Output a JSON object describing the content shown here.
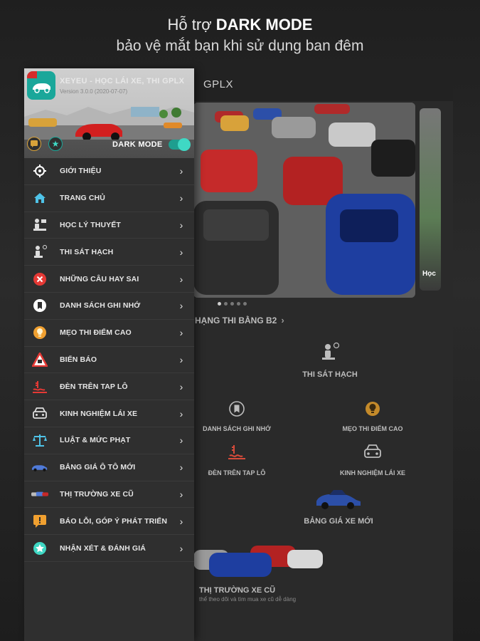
{
  "promo": {
    "line1_prefix": "Hỗ trợ ",
    "line1_bold": "DARK MODE",
    "line2": "bảo vệ mắt bạn khi sử dụng ban đêm"
  },
  "appbar": {
    "title_fragment": "GPLX"
  },
  "drawer": {
    "app_name": "XEYEU - HỌC LÁI XE, THI GPLX",
    "version": "Version 3.0.0 (2020-07-07)",
    "dark_mode_label": "DARK MODE",
    "dark_mode_on": true,
    "items": [
      {
        "label": "GIỚI THIỆU",
        "icon": "crosshair-icon"
      },
      {
        "label": "TRANG CHỦ",
        "icon": "home-icon"
      },
      {
        "label": "HỌC LÝ THUYẾT",
        "icon": "study-icon"
      },
      {
        "label": "THI SÁT HẠCH",
        "icon": "exam-icon"
      },
      {
        "label": "NHỮNG CÂU HAY SAI",
        "icon": "error-icon"
      },
      {
        "label": "DANH SÁCH GHI NHỚ",
        "icon": "bookmark-icon"
      },
      {
        "label": "MẸO THI ĐIỂM CAO",
        "icon": "lightbulb-icon"
      },
      {
        "label": "BIỂN BÁO",
        "icon": "warning-sign-icon"
      },
      {
        "label": "ĐÈN TRÊN TAP LÔ",
        "icon": "dashboard-light-icon"
      },
      {
        "label": "KINH NGHIỆM LÁI XE",
        "icon": "car-front-icon"
      },
      {
        "label": "LUẬT & MỨC PHẠT",
        "icon": "scales-icon"
      },
      {
        "label": "BẢNG GIÁ Ô TÔ MỚI",
        "icon": "new-car-icon"
      },
      {
        "label": "THỊ TRƯỜNG XE CŨ",
        "icon": "used-car-icon"
      },
      {
        "label": "BÁO LỖI, GÓP Ý PHÁT TRIỂN",
        "icon": "feedback-icon"
      },
      {
        "label": "NHẬN XÉT & ĐÁNH GIÁ",
        "icon": "star-icon"
      }
    ]
  },
  "main": {
    "banner_next_label": "Học",
    "license_link": "HẠNG THI BẰNG B2",
    "tiles": {
      "exam": "THI SÁT HẠCH",
      "bookmarks": "DANH SÁCH GHI NHỚ",
      "tips": "MẸO THI ĐIỂM CAO",
      "dashboard": "ĐÈN TRÊN TAP LÔ",
      "experience": "KINH NGHIỆM LÁI XE",
      "price": "BẢNG GIÁ XE MỚI",
      "market": "THỊ TRƯỜNG XE CŨ",
      "market_sub": "thể theo dõi và tìm mua xe cũ dễ dàng"
    }
  },
  "colors": {
    "accent": "#3fd8c4",
    "drawer_bg": "#2f2f2f",
    "app_icon": "#1aa79a"
  }
}
